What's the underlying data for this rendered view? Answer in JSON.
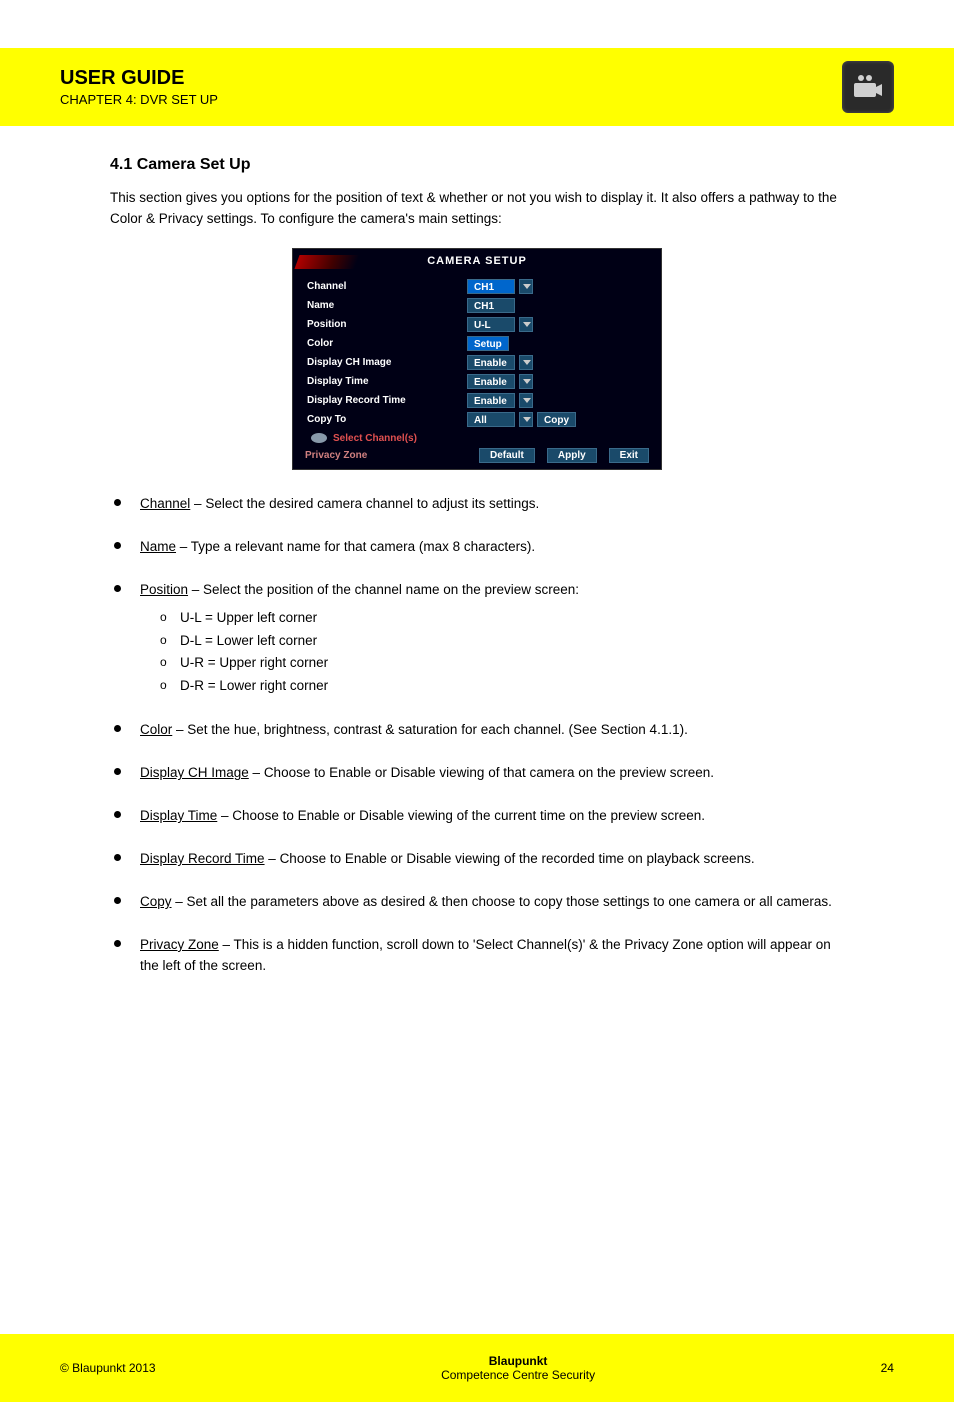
{
  "header": {
    "title": "USER GUIDE",
    "subtitle": "CHAPTER 4: DVR SET UP",
    "icon": "camera-icon"
  },
  "section": {
    "heading": "4.1 Camera Set Up",
    "intro": "This section gives you options for the position of text & whether or not you wish to display it. It also offers a pathway to the Color & Privacy settings. To configure the camera's main settings:"
  },
  "screenshot": {
    "title": "CAMERA  SETUP",
    "rows": [
      {
        "label": "Channel",
        "value": "CH1",
        "type": "select-sel"
      },
      {
        "label": "Name",
        "value": "CH1",
        "type": "input"
      },
      {
        "label": "Position",
        "value": "U-L",
        "type": "select"
      },
      {
        "label": "Color",
        "value": "Setup",
        "type": "button"
      },
      {
        "label": "Display  CH  Image",
        "value": "Enable",
        "type": "select"
      },
      {
        "label": "Display  Time",
        "value": "Enable",
        "type": "select"
      },
      {
        "label": "Display  Record  Time",
        "value": "Enable",
        "type": "select"
      },
      {
        "label": "Copy  To",
        "value": "All",
        "type": "select",
        "extra_btn": "Copy"
      }
    ],
    "select_channels": "Select  Channel(s)",
    "privacy_zone": "Privacy  Zone",
    "footer_buttons": [
      "Default",
      "Apply",
      "Exit"
    ]
  },
  "bullets": [
    {
      "label": "Channel",
      "sep": " – ",
      "text": "Select the desired camera channel to adjust its settings."
    },
    {
      "label": "Name",
      "sep": " – ",
      "text": "Type a relevant name for that camera (max 8 characters)."
    },
    {
      "label": "Position",
      "sep": " – ",
      "text": "Select the position of the channel name on the preview screen:",
      "sublist": [
        "U-L = Upper left corner",
        "D-L = Lower left corner",
        "U-R = Upper right corner",
        "D-R = Lower right corner"
      ]
    },
    {
      "label": "Color",
      "sep": " – ",
      "text": "Set the hue, brightness, contrast & saturation for each channel. (See Section 4.1.1)."
    },
    {
      "label": "Display CH Image",
      "sep": " – ",
      "text": "Choose to Enable or Disable viewing of that camera on the preview screen."
    },
    {
      "label": "Display Time",
      "sep": " – ",
      "text": "Choose to Enable or Disable viewing of the current time on the preview screen."
    },
    {
      "label": "Display Record Time",
      "sep": " – ",
      "text": "Choose to Enable or Disable viewing of the recorded time on playback screens."
    },
    {
      "label": "Copy",
      "sep": " – ",
      "text": "Set all the parameters above as desired & then choose to copy those settings to one camera or all cameras."
    },
    {
      "label": "Privacy Zone",
      "sep": " – ",
      "text": "This is a hidden function, scroll down to 'Select Channel(s)' & the Privacy Zone option will appear on the left of the screen."
    }
  ],
  "footer": {
    "left": "© Blaupunkt 2013",
    "mid_line1": "Blaupunkt",
    "mid_line2": "Competence Centre Security",
    "right": "24"
  }
}
